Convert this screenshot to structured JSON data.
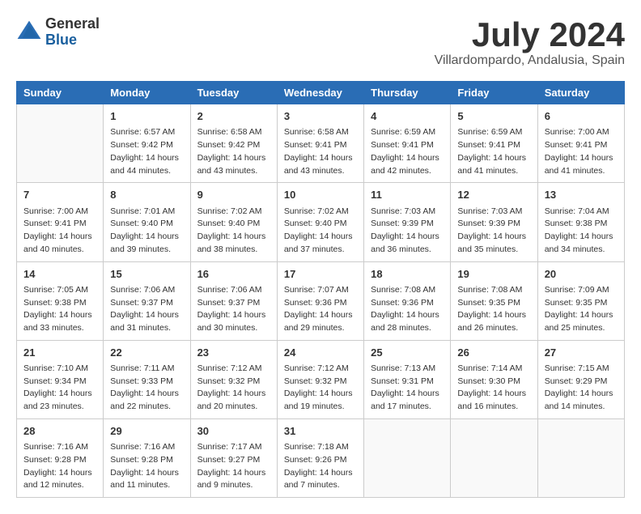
{
  "logo": {
    "general": "General",
    "blue": "Blue"
  },
  "title": {
    "month": "July 2024",
    "location": "Villardompardo, Andalusia, Spain"
  },
  "headers": [
    "Sunday",
    "Monday",
    "Tuesday",
    "Wednesday",
    "Thursday",
    "Friday",
    "Saturday"
  ],
  "weeks": [
    [
      {
        "day": "",
        "sunrise": "",
        "sunset": "",
        "daylight": ""
      },
      {
        "day": "1",
        "sunrise": "Sunrise: 6:57 AM",
        "sunset": "Sunset: 9:42 PM",
        "daylight": "Daylight: 14 hours and 44 minutes."
      },
      {
        "day": "2",
        "sunrise": "Sunrise: 6:58 AM",
        "sunset": "Sunset: 9:42 PM",
        "daylight": "Daylight: 14 hours and 43 minutes."
      },
      {
        "day": "3",
        "sunrise": "Sunrise: 6:58 AM",
        "sunset": "Sunset: 9:41 PM",
        "daylight": "Daylight: 14 hours and 43 minutes."
      },
      {
        "day": "4",
        "sunrise": "Sunrise: 6:59 AM",
        "sunset": "Sunset: 9:41 PM",
        "daylight": "Daylight: 14 hours and 42 minutes."
      },
      {
        "day": "5",
        "sunrise": "Sunrise: 6:59 AM",
        "sunset": "Sunset: 9:41 PM",
        "daylight": "Daylight: 14 hours and 41 minutes."
      },
      {
        "day": "6",
        "sunrise": "Sunrise: 7:00 AM",
        "sunset": "Sunset: 9:41 PM",
        "daylight": "Daylight: 14 hours and 41 minutes."
      }
    ],
    [
      {
        "day": "7",
        "sunrise": "Sunrise: 7:00 AM",
        "sunset": "Sunset: 9:41 PM",
        "daylight": "Daylight: 14 hours and 40 minutes."
      },
      {
        "day": "8",
        "sunrise": "Sunrise: 7:01 AM",
        "sunset": "Sunset: 9:40 PM",
        "daylight": "Daylight: 14 hours and 39 minutes."
      },
      {
        "day": "9",
        "sunrise": "Sunrise: 7:02 AM",
        "sunset": "Sunset: 9:40 PM",
        "daylight": "Daylight: 14 hours and 38 minutes."
      },
      {
        "day": "10",
        "sunrise": "Sunrise: 7:02 AM",
        "sunset": "Sunset: 9:40 PM",
        "daylight": "Daylight: 14 hours and 37 minutes."
      },
      {
        "day": "11",
        "sunrise": "Sunrise: 7:03 AM",
        "sunset": "Sunset: 9:39 PM",
        "daylight": "Daylight: 14 hours and 36 minutes."
      },
      {
        "day": "12",
        "sunrise": "Sunrise: 7:03 AM",
        "sunset": "Sunset: 9:39 PM",
        "daylight": "Daylight: 14 hours and 35 minutes."
      },
      {
        "day": "13",
        "sunrise": "Sunrise: 7:04 AM",
        "sunset": "Sunset: 9:38 PM",
        "daylight": "Daylight: 14 hours and 34 minutes."
      }
    ],
    [
      {
        "day": "14",
        "sunrise": "Sunrise: 7:05 AM",
        "sunset": "Sunset: 9:38 PM",
        "daylight": "Daylight: 14 hours and 33 minutes."
      },
      {
        "day": "15",
        "sunrise": "Sunrise: 7:06 AM",
        "sunset": "Sunset: 9:37 PM",
        "daylight": "Daylight: 14 hours and 31 minutes."
      },
      {
        "day": "16",
        "sunrise": "Sunrise: 7:06 AM",
        "sunset": "Sunset: 9:37 PM",
        "daylight": "Daylight: 14 hours and 30 minutes."
      },
      {
        "day": "17",
        "sunrise": "Sunrise: 7:07 AM",
        "sunset": "Sunset: 9:36 PM",
        "daylight": "Daylight: 14 hours and 29 minutes."
      },
      {
        "day": "18",
        "sunrise": "Sunrise: 7:08 AM",
        "sunset": "Sunset: 9:36 PM",
        "daylight": "Daylight: 14 hours and 28 minutes."
      },
      {
        "day": "19",
        "sunrise": "Sunrise: 7:08 AM",
        "sunset": "Sunset: 9:35 PM",
        "daylight": "Daylight: 14 hours and 26 minutes."
      },
      {
        "day": "20",
        "sunrise": "Sunrise: 7:09 AM",
        "sunset": "Sunset: 9:35 PM",
        "daylight": "Daylight: 14 hours and 25 minutes."
      }
    ],
    [
      {
        "day": "21",
        "sunrise": "Sunrise: 7:10 AM",
        "sunset": "Sunset: 9:34 PM",
        "daylight": "Daylight: 14 hours and 23 minutes."
      },
      {
        "day": "22",
        "sunrise": "Sunrise: 7:11 AM",
        "sunset": "Sunset: 9:33 PM",
        "daylight": "Daylight: 14 hours and 22 minutes."
      },
      {
        "day": "23",
        "sunrise": "Sunrise: 7:12 AM",
        "sunset": "Sunset: 9:32 PM",
        "daylight": "Daylight: 14 hours and 20 minutes."
      },
      {
        "day": "24",
        "sunrise": "Sunrise: 7:12 AM",
        "sunset": "Sunset: 9:32 PM",
        "daylight": "Daylight: 14 hours and 19 minutes."
      },
      {
        "day": "25",
        "sunrise": "Sunrise: 7:13 AM",
        "sunset": "Sunset: 9:31 PM",
        "daylight": "Daylight: 14 hours and 17 minutes."
      },
      {
        "day": "26",
        "sunrise": "Sunrise: 7:14 AM",
        "sunset": "Sunset: 9:30 PM",
        "daylight": "Daylight: 14 hours and 16 minutes."
      },
      {
        "day": "27",
        "sunrise": "Sunrise: 7:15 AM",
        "sunset": "Sunset: 9:29 PM",
        "daylight": "Daylight: 14 hours and 14 minutes."
      }
    ],
    [
      {
        "day": "28",
        "sunrise": "Sunrise: 7:16 AM",
        "sunset": "Sunset: 9:28 PM",
        "daylight": "Daylight: 14 hours and 12 minutes."
      },
      {
        "day": "29",
        "sunrise": "Sunrise: 7:16 AM",
        "sunset": "Sunset: 9:28 PM",
        "daylight": "Daylight: 14 hours and 11 minutes."
      },
      {
        "day": "30",
        "sunrise": "Sunrise: 7:17 AM",
        "sunset": "Sunset: 9:27 PM",
        "daylight": "Daylight: 14 hours and 9 minutes."
      },
      {
        "day": "31",
        "sunrise": "Sunrise: 7:18 AM",
        "sunset": "Sunset: 9:26 PM",
        "daylight": "Daylight: 14 hours and 7 minutes."
      },
      {
        "day": "",
        "sunrise": "",
        "sunset": "",
        "daylight": ""
      },
      {
        "day": "",
        "sunrise": "",
        "sunset": "",
        "daylight": ""
      },
      {
        "day": "",
        "sunrise": "",
        "sunset": "",
        "daylight": ""
      }
    ]
  ]
}
